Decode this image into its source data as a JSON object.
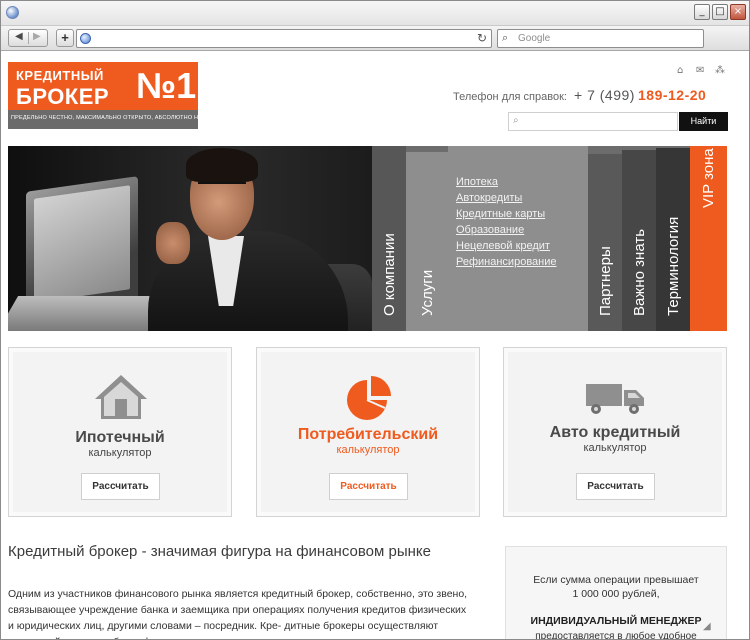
{
  "browser": {
    "window_buttons": {
      "minimize": "_",
      "maximize": "□",
      "close": "×"
    },
    "nav": {
      "back_icon": "◀",
      "forward_icon": "▶",
      "new_tab_icon": "+",
      "reload_icon": "↻"
    },
    "search_placeholder": "Google"
  },
  "header": {
    "logo": {
      "line1": "КРЕДИТНЫЙ",
      "line2": "БРОКЕР",
      "number": "№1",
      "tagline": "ПРЕДЕЛЬНО ЧЕСТНО, МАКСИМАЛЬНО ОТКРЫТО, АБСОЛЮТНО НАДЕЖНО."
    },
    "top_icons": [
      "home-icon",
      "mail-icon",
      "sitemap-icon"
    ],
    "phone": {
      "label": "Телефон для справок:",
      "code": "+ 7 (499)",
      "number": "189-12-20"
    },
    "search": {
      "button": "Найти"
    }
  },
  "hero": {
    "tabs": {
      "about": "О компании",
      "services": "Услуги",
      "partners": "Партнеры",
      "know": "Важно знать",
      "terms": "Терминология",
      "vip": "VIP зона"
    },
    "submenu": [
      "Ипотека",
      "Автокредиты",
      "Кредитные карты",
      "Образование",
      "Нецелевой кредит",
      "Рефинансирование"
    ]
  },
  "calculators": [
    {
      "title": "Ипотечный",
      "subtitle": "калькулятор",
      "button": "Рассчитать"
    },
    {
      "title": "Потребительский",
      "subtitle": "калькулятор",
      "button": "Рассчитать"
    },
    {
      "title": "Авто кредитный",
      "subtitle": "калькулятор",
      "button": "Рассчитать"
    }
  ],
  "article": {
    "title": "Кредитный брокер - значимая фигура на финансовом рынке",
    "text": "Одним из участников финансового рынка является кредитный брокер, собственно, это звено, связывающее учреждение банка и заемщика при операциях получения кредитов физических и юридических лиц, другими словами – посредник. Кре- дитные брокеры осуществляют взаимодействие с любыми финансовыми организацие-"
  },
  "sidebox": {
    "line1": "Если сумма операции превышает",
    "line2": "1 000 000 рублей,",
    "line3": "ИНДИВИДУАЛЬНЫЙ МЕНЕДЖЕР",
    "line4": "предоставляется в любое удобное"
  },
  "colors": {
    "accent": "#ef5a1e",
    "menu_gray": "#8e8e8e",
    "dark": "#111111"
  }
}
